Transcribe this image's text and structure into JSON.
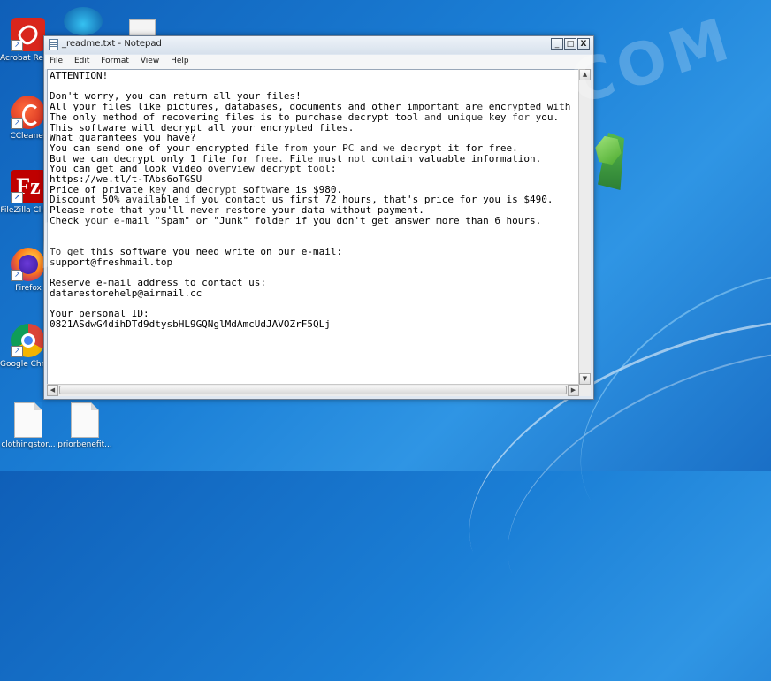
{
  "desktop": {
    "icons": [
      {
        "label": "Acrobat Reader DC",
        "icon": "acrobat-icon"
      },
      {
        "label": "CCleaner",
        "icon": "ccleaner-icon"
      },
      {
        "label": "FileZilla Client",
        "icon": "filezilla-icon",
        "glyph": "Fz"
      },
      {
        "label": "Firefox",
        "icon": "firefox-icon"
      },
      {
        "label": "Google Chrome",
        "icon": "chrome-icon"
      },
      {
        "label": "clothingstor...",
        "icon": "file-icon"
      },
      {
        "label": "priorbenefit...",
        "icon": "file-icon"
      }
    ],
    "watermark": "ANTISPYWARE.COM"
  },
  "notepad": {
    "title": "_readme.txt - Notepad",
    "buttons": {
      "minimize": "_",
      "maximize": "□",
      "close": "X"
    },
    "menu": [
      "File",
      "Edit",
      "Format",
      "View",
      "Help"
    ],
    "text": "ATTENTION!\n\nDon't worry, you can return all your files!\nAll your files like pictures, databases, documents and other important are encrypted with\nThe only method of recovering files is to purchase decrypt tool and unique key for you.\nThis software will decrypt all your encrypted files.\nWhat guarantees you have?\nYou can send one of your encrypted file from your PC and we decrypt it for free.\nBut we can decrypt only 1 file for free. File must not contain valuable information.\nYou can get and look video overview decrypt tool:\nhttps://we.tl/t-TAbs6oTGSU\nPrice of private key and decrypt software is $980.\nDiscount 50% available if you contact us first 72 hours, that's price for you is $490.\nPlease note that you'll never restore your data without payment.\nCheck your e-mail \"Spam\" or \"Junk\" folder if you don't get answer more than 6 hours.\n\n\nTo get this software you need write on our e-mail:\nsupport@freshmail.top\n\nReserve e-mail address to contact us:\ndatarestorehelp@airmail.cc\n\nYour personal ID:\n0821ASdwG4dihDTd9dtysbHL9GQNglMdAmcUdJAVOZrF5QLj",
    "scroll_arrows": {
      "up": "▲",
      "down": "▼",
      "left": "◀",
      "right": "▶"
    }
  }
}
